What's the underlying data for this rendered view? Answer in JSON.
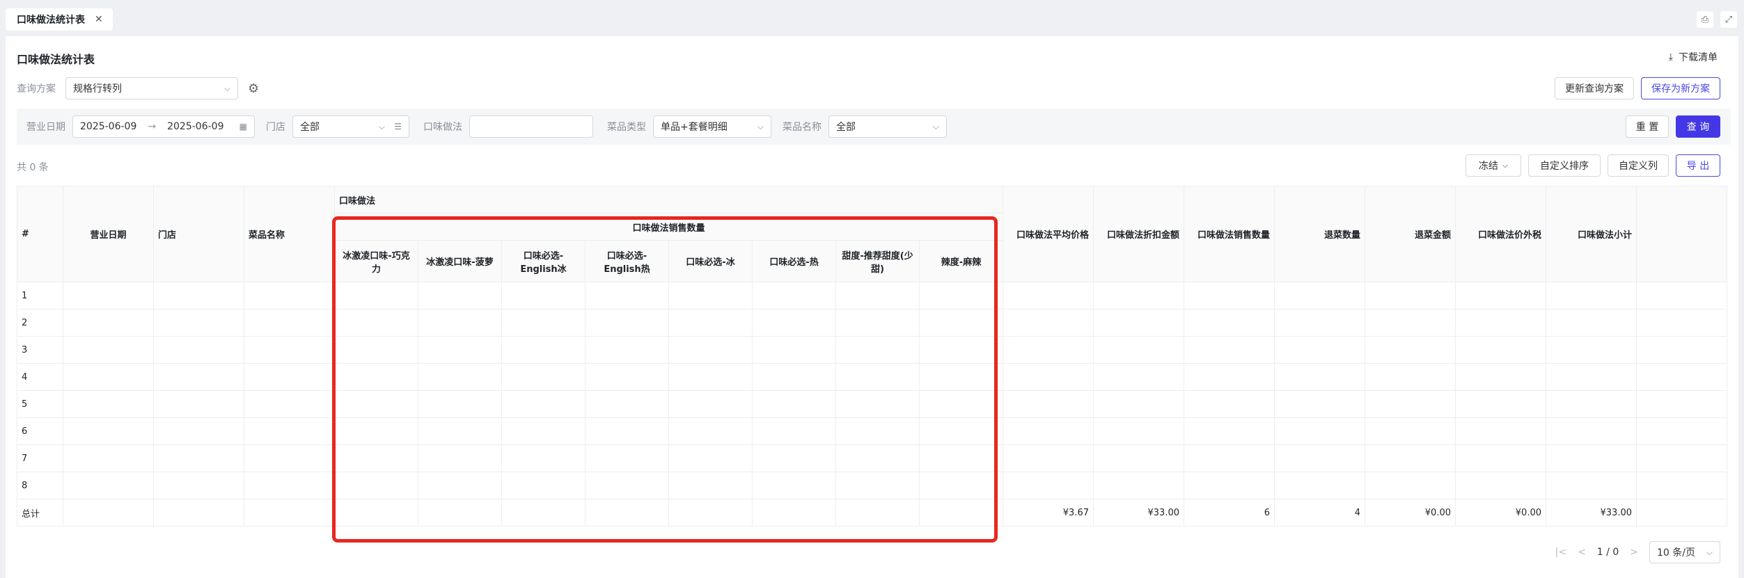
{
  "tab": {
    "label": "口味做法统计表",
    "close": "✕"
  },
  "page": {
    "title": "口味做法统计表",
    "download_label": "下载清单"
  },
  "query": {
    "label": "查询方案",
    "scheme_value": "规格行转列",
    "update_button": "更新查询方案",
    "save_new_button": "保存为新方案"
  },
  "filters": {
    "date_label": "营业日期",
    "date_start": "2025-06-09",
    "date_arrow": "→",
    "date_end": "2025-06-09",
    "store_label": "门店",
    "store_value": "全部",
    "flavor_label": "口味做法",
    "flavor_value": "",
    "dish_type_label": "菜品类型",
    "dish_type_value": "单品+套餐明细",
    "dish_name_label": "菜品名称",
    "dish_name_value": "全部",
    "reset_button": "重 置",
    "search_button": "查 询"
  },
  "toolbar": {
    "count": "共 0 条",
    "freeze": "冻结",
    "custom_sort": "自定义排序",
    "custom_cols": "自定义列",
    "export": "导 出"
  },
  "table": {
    "headers": {
      "index": "#",
      "date": "营业日期",
      "store": "门店",
      "dish": "菜品名称",
      "group": "口味做法",
      "subgroup": "口味做法销售数量",
      "avg_price": "口味做法平均价格",
      "discount": "口味做法折扣金额",
      "sales_qty": "口味做法销售数量",
      "refund_qty": "退菜数量",
      "refund_amt": "退菜金额",
      "tax": "口味做法价外税",
      "subtotal": "口味做法小计"
    },
    "flavor_columns": [
      "冰激凌口味-巧克力",
      "冰激凌口味-菠萝",
      "口味必选-English冰",
      "口味必选-English热",
      "口味必选-冰",
      "口味必选-热",
      "甜度-推荐甜度(少甜)",
      "辣度-麻辣"
    ],
    "rows": [
      "1",
      "2",
      "3",
      "4",
      "5",
      "6",
      "7",
      "8"
    ],
    "total": {
      "label": "总计",
      "avg_price": "¥3.67",
      "discount": "¥33.00",
      "sales_qty": "6",
      "refund_qty": "4",
      "refund_amt": "¥0.00",
      "tax": "¥0.00",
      "subtotal": "¥33.00"
    }
  },
  "pager": {
    "first": "|<",
    "prev": "<",
    "page": "1",
    "sep": "/",
    "total_pages": "0",
    "next": ">",
    "page_size": "10 条/页"
  },
  "colors": {
    "primary": "#4438e6",
    "highlight": "#e8271f"
  }
}
